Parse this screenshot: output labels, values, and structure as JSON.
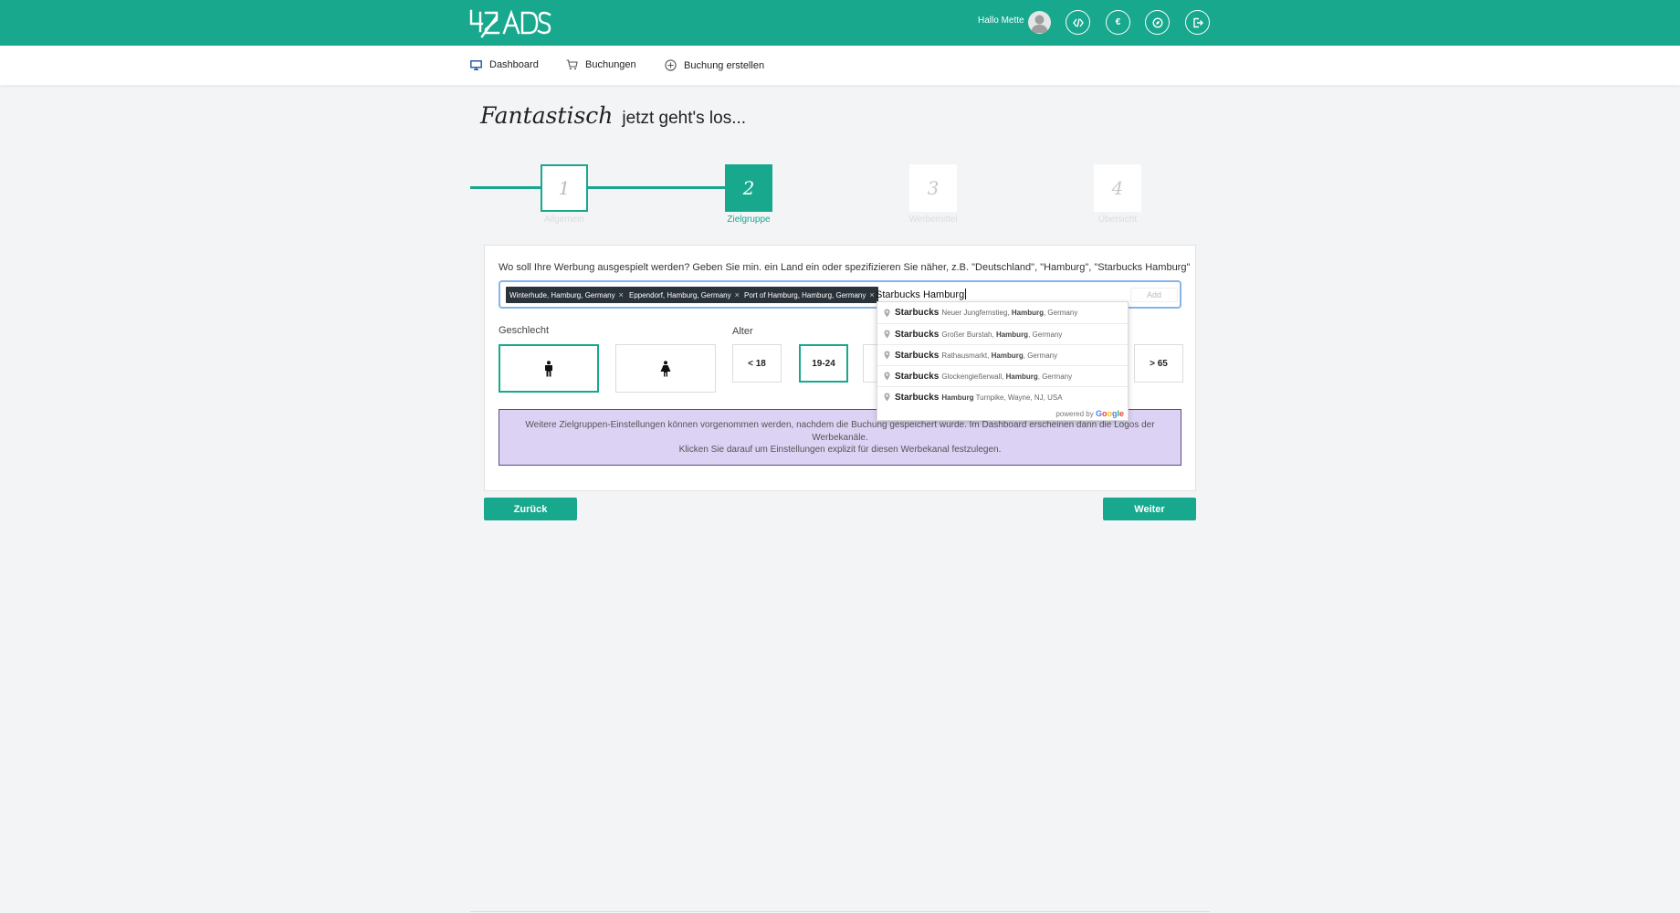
{
  "header": {
    "logo_text": "42ADS",
    "greeting": "Hallo Mette",
    "icons": [
      "code-icon",
      "euro-icon",
      "compass-icon",
      "logout-icon"
    ],
    "euro_symbol": "€",
    "brand_color": "#17a88e"
  },
  "nav": {
    "items": [
      {
        "label": "Dashboard",
        "icon": "monitor-icon"
      },
      {
        "label": "Buchungen",
        "icon": "cart-icon"
      },
      {
        "label": "Buchung erstellen",
        "icon": "plus-circle-icon"
      }
    ]
  },
  "headline": {
    "script": "Fantastisch",
    "plain": "jetzt geht's los..."
  },
  "stepper": {
    "current_step": 2,
    "steps": [
      {
        "number": "1",
        "label": "Allgemein",
        "state": "done"
      },
      {
        "number": "2",
        "label": "Zielgruppe",
        "state": "active"
      },
      {
        "number": "3",
        "label": "Werbemittel",
        "state": "todo"
      },
      {
        "number": "4",
        "label": "Übersicht",
        "state": "todo"
      }
    ]
  },
  "location": {
    "question": "Wo soll Ihre Werbung ausgespielt werden? Geben Sie min. ein Land ein oder spezifizieren Sie näher, z.B. \"Deutschland\", \"Hamburg\", \"Starbucks Hamburg\"",
    "tags": [
      {
        "label": "Winterhude, Hamburg, Germany"
      },
      {
        "label": "Eppendorf, Hamburg, Germany"
      },
      {
        "label": "Port of Hamburg, Hamburg, Germany"
      }
    ],
    "tag_remove": "×",
    "input_value": "Starbucks Hamburg",
    "add_label": "Add",
    "suggestions": [
      {
        "main": "Starbucks",
        "street": "Neuer Jungfernstieg,",
        "city": "Hamburg",
        "rest": ", Germany"
      },
      {
        "main": "Starbucks",
        "street": "Großer Burstah,",
        "city": "Hamburg",
        "rest": ", Germany"
      },
      {
        "main": "Starbucks",
        "street": "Rathausmarkt,",
        "city": "Hamburg",
        "rest": ", Germany"
      },
      {
        "main": "Starbucks",
        "street": "Glockengießerwall,",
        "city": "Hamburg",
        "rest": ", Germany"
      },
      {
        "main": "Starbucks",
        "street": "",
        "city": "Hamburg",
        "rest": " Turnpike, Wayne, NJ, USA"
      }
    ],
    "powered_by": "powered by",
    "powered_brand": "Google"
  },
  "gender": {
    "label": "Geschlecht",
    "options": [
      {
        "icon": "male-icon",
        "selected": true
      },
      {
        "icon": "female-icon",
        "selected": false
      }
    ]
  },
  "age": {
    "label": "Alter",
    "options": [
      {
        "label": "< 18",
        "selected": false
      },
      {
        "label": "19-24",
        "selected": true
      },
      {
        "label": "> 65",
        "selected": false
      }
    ]
  },
  "info": {
    "line1": "Weitere Zielgruppen-Einstellungen können vorgenommen werden, nachdem die Buchung gespeichert wurde. Im Dashboard erscheinen dann die Logos der",
    "line2": "Werbekanäle.",
    "line3": "Klicken Sie darauf um Einstellungen explizit für diesen Werbekanal festzulegen."
  },
  "footer": {
    "back_label": "Zurück",
    "next_label": "Weiter"
  }
}
